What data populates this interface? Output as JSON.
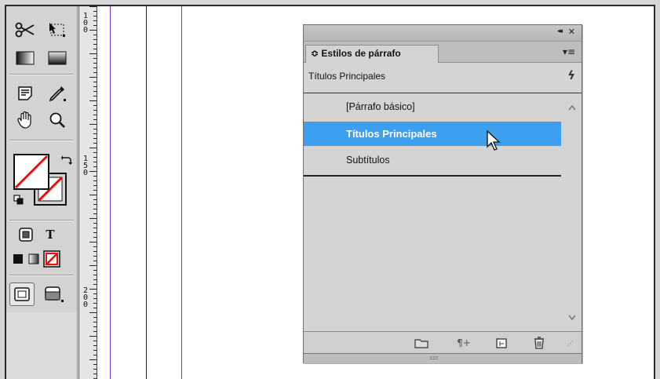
{
  "toolbox": {
    "icons": [
      "scissors-icon",
      "free-transform-icon",
      "gradient-swatch-icon",
      "gradient-feather-icon",
      "note-icon",
      "eyedropper-icon",
      "hand-icon",
      "zoom-icon",
      "fill-stroke-icon",
      "swap-icon",
      "default-colors-icon",
      "format-container-icon",
      "format-text-icon",
      "apply-color-icon",
      "apply-gradient-icon",
      "apply-none-icon",
      "normal-view-icon",
      "preview-mode-icon"
    ],
    "text_tool_glyph": "T"
  },
  "ruler": {
    "labels": [
      "100",
      "150",
      "200"
    ]
  },
  "panel": {
    "collapse_glyph": "◂◂",
    "close_glyph": "✕",
    "tab_label": "≎ Estilos de párrafo",
    "menu_glyph": "▾≡",
    "current_style": "Títulos Principales",
    "lightning_glyph": "ϟ",
    "items": [
      {
        "label": "[Párrafo básico]",
        "selected": false
      },
      {
        "label": "Títulos Principales",
        "selected": true
      },
      {
        "label": "Subtítulos",
        "selected": false
      }
    ],
    "footer_icons": [
      "folder-icon",
      "clear-overrides-icon",
      "new-style-icon",
      "delete-style-icon"
    ],
    "clear_overrides_glyph": "¶+",
    "resize_grip": "::::::::"
  },
  "colors": {
    "selection": "#3d9ff0",
    "guide": "#7a2fd0"
  }
}
